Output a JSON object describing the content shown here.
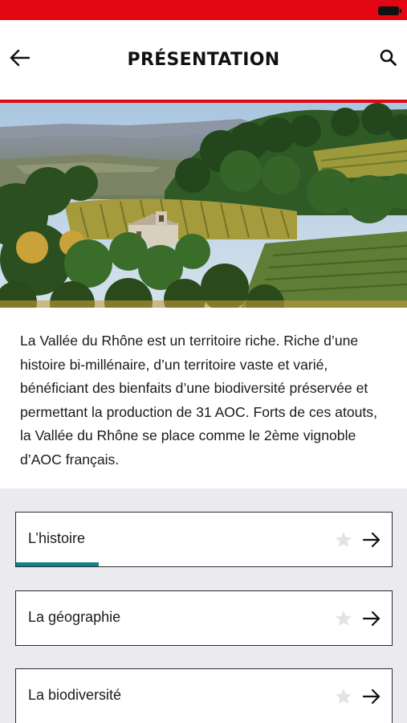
{
  "header": {
    "title": "PRÉSENTATION",
    "back_icon": "arrow-left-icon",
    "search_icon": "search-icon"
  },
  "intro": {
    "text": "La Vallée du Rhône est un territoire riche. Riche d’une histoire bi-millénaire, d’un territoire vaste et varié, bénéficiant des bienfaits d’une biodiversité préservée et permettant la production de 31 AOC. Forts de ces atouts, la Vallée du Rhône se place comme le 2ème vignoble d’AOC français."
  },
  "menu": {
    "items": [
      {
        "label": "L’histoire",
        "progress": 0.22
      },
      {
        "label": "La géographie",
        "progress": 0
      },
      {
        "label": "La biodiversité",
        "progress": 0
      }
    ]
  },
  "colors": {
    "brand_red": "#e30613",
    "progress_teal": "#15808f",
    "star_grey": "#e3e3e3"
  }
}
